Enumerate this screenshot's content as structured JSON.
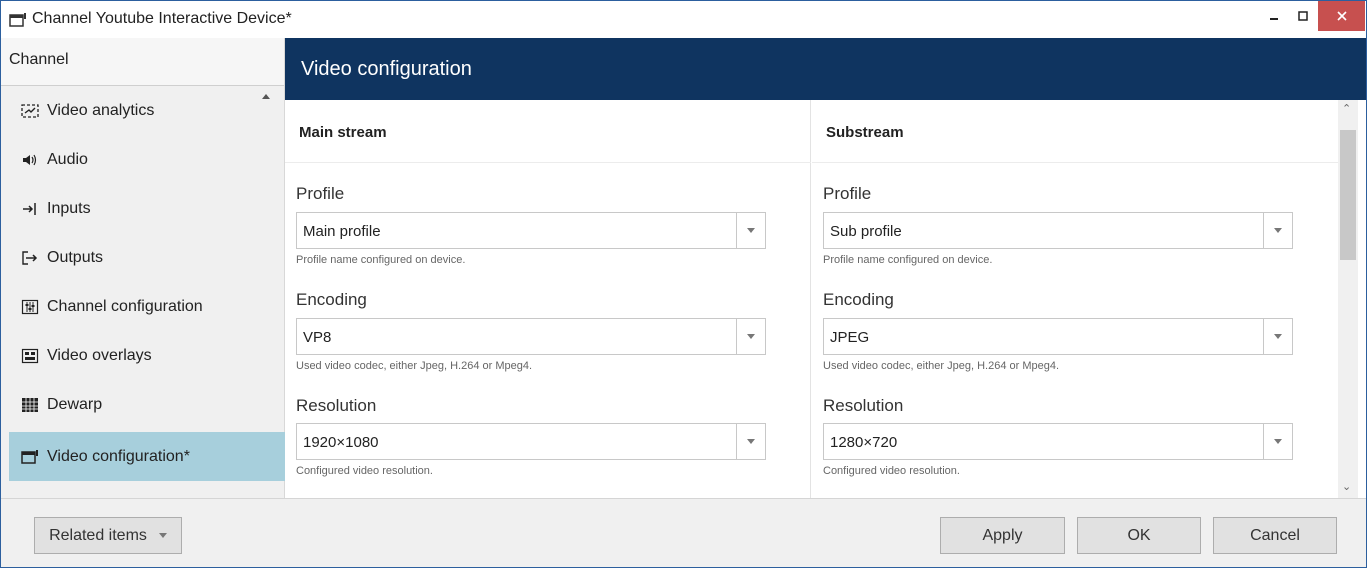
{
  "window": {
    "title": "Channel Youtube Interactive Device*"
  },
  "sidebar": {
    "header": "Channel",
    "items": [
      {
        "label": "Video analytics",
        "icon": "video-analytics-icon"
      },
      {
        "label": "Audio",
        "icon": "speaker-icon"
      },
      {
        "label": "Inputs",
        "icon": "input-arrow-icon"
      },
      {
        "label": "Outputs",
        "icon": "output-arrow-icon"
      },
      {
        "label": "Channel configuration",
        "icon": "sliders-icon"
      },
      {
        "label": "Video overlays",
        "icon": "overlay-icon"
      },
      {
        "label": "Dewarp",
        "icon": "dewarp-grid-icon"
      },
      {
        "label": "Video configuration*",
        "icon": "video-config-icon",
        "active": true
      }
    ]
  },
  "main": {
    "title": "Video configuration",
    "main_stream": {
      "title": "Main stream",
      "profile": {
        "label": "Profile",
        "value": "Main profile",
        "hint": "Profile name configured on device."
      },
      "encoding": {
        "label": "Encoding",
        "value": "VP8",
        "hint": "Used video codec, either Jpeg, H.264 or Mpeg4."
      },
      "resolution": {
        "label": "Resolution",
        "value": "1920×1080",
        "hint": "Configured video resolution."
      }
    },
    "substream": {
      "title": "Substream",
      "profile": {
        "label": "Profile",
        "value": "Sub profile",
        "hint": "Profile name configured on device."
      },
      "encoding": {
        "label": "Encoding",
        "value": "JPEG",
        "hint": "Used video codec, either Jpeg, H.264 or Mpeg4."
      },
      "resolution": {
        "label": "Resolution",
        "value": "1280×720",
        "hint": "Configured video resolution."
      }
    }
  },
  "footer": {
    "related_label": "Related items",
    "apply_label": "Apply",
    "ok_label": "OK",
    "cancel_label": "Cancel"
  },
  "colors": {
    "header_bg": "#0f3460",
    "active_item_bg": "#a7cfdc",
    "close_button_bg": "#c7504f"
  }
}
